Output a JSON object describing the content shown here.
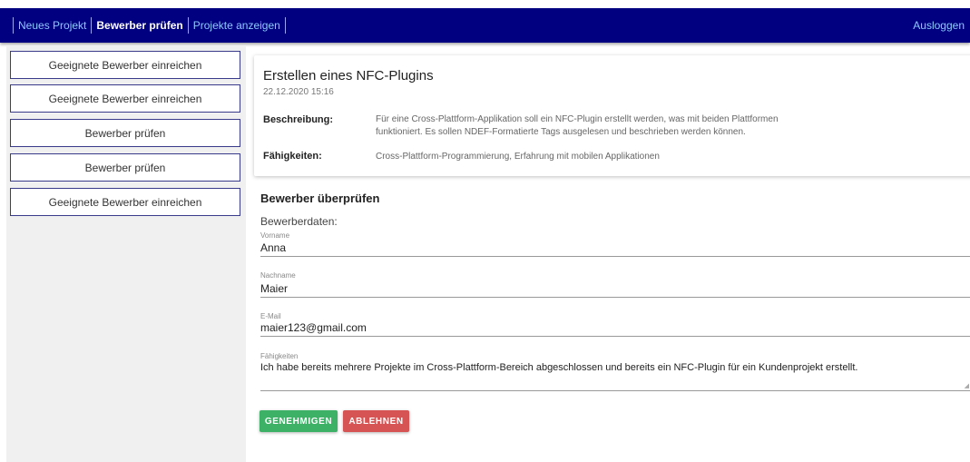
{
  "nav": {
    "links": [
      "Neues Projekt",
      "Bewerber prüfen",
      "Projekte anzeigen"
    ],
    "active": "Bewerber prüfen",
    "logout": "Ausloggen"
  },
  "sidebar": {
    "items": [
      "Geeignete Bewerber einreichen",
      "Geeignete Bewerber einreichen",
      "Bewerber prüfen",
      "Bewerber prüfen",
      "Geeignete Bewerber einreichen"
    ]
  },
  "project": {
    "title": "Erstellen eines NFC-Plugins",
    "date": "22.12.2020 15:16",
    "description_label": "Beschreibung:",
    "description": "Für eine Cross-Plattform-Applikation soll ein NFC-Plugin erstellt werden, was mit beiden Plattformen funktioniert. Es sollen NDEF-Formatierte Tags ausgelesen und beschrieben werden können.",
    "skills_label": "Fähigkeiten:",
    "skills": "Cross-Plattform-Programmierung, Erfahrung mit mobilen Applikationen"
  },
  "review": {
    "title": "Bewerber überprüfen",
    "data_label": "Bewerberdaten:",
    "fields": {
      "firstname": {
        "label": "Vorname",
        "value": "Anna"
      },
      "lastname": {
        "label": "Nachname",
        "value": "Maier"
      },
      "email": {
        "label": "E-Mail",
        "value": "maier123@gmail.com"
      },
      "skills": {
        "label": "Fähigkeiten",
        "value": "Ich habe bereits mehrere Projekte im Cross-Plattform-Bereich abgeschlossen und bereits ein NFC-Plugin für ein Kundenprojekt erstellt."
      }
    },
    "approve_label": "GENEHMIGEN",
    "reject_label": "ABLEHNEN"
  },
  "colors": {
    "navbar": "#000080",
    "approve": "#3db166",
    "reject": "#d65454"
  }
}
